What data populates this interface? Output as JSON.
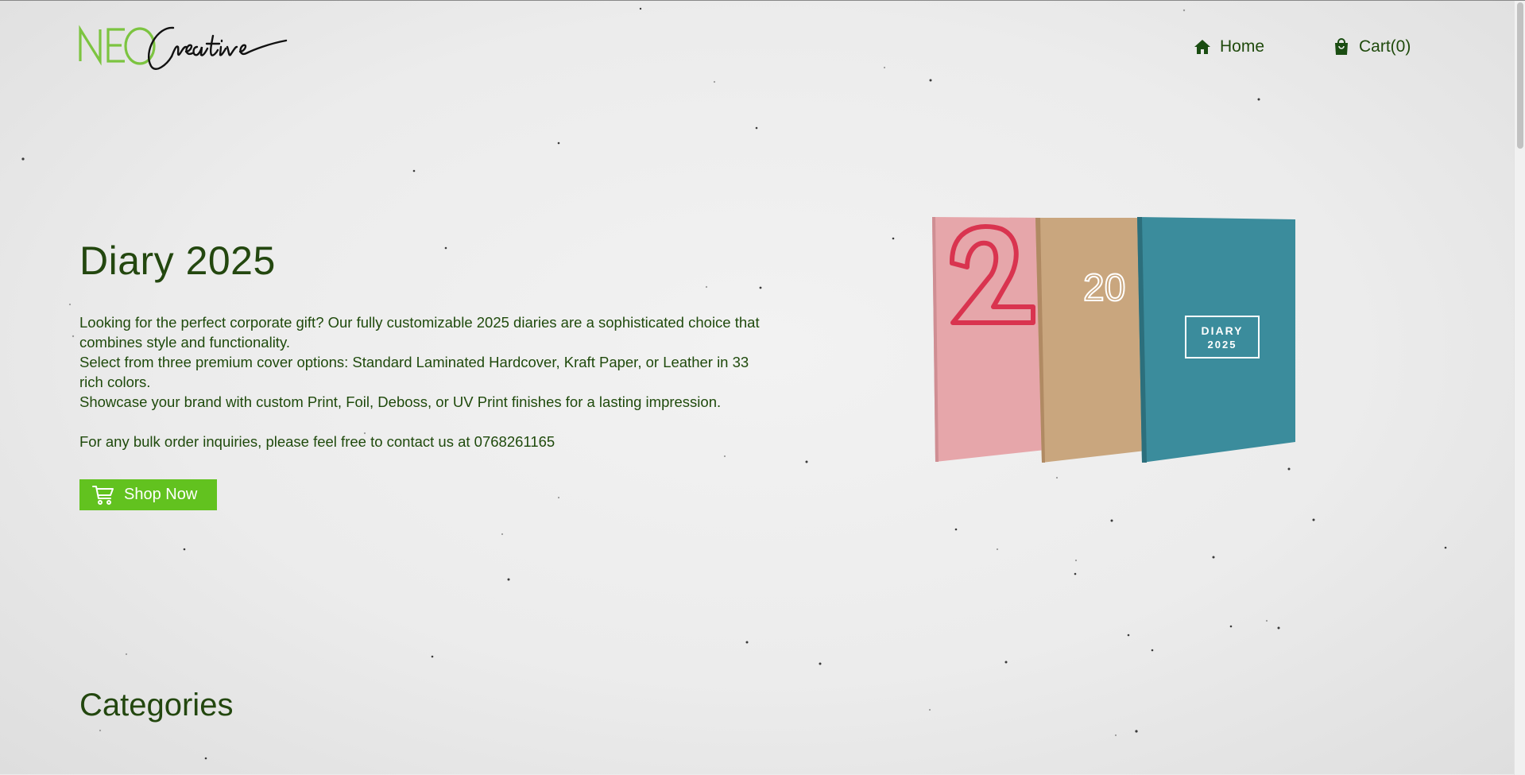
{
  "header": {
    "logo": {
      "primary": "NEO",
      "script": "Creative",
      "accent": "#7cc440"
    },
    "nav": [
      {
        "label": "Home",
        "icon": "home-icon"
      },
      {
        "label": "Cart(0)",
        "icon": "shopping-bag-icon"
      }
    ]
  },
  "hero": {
    "title": "Diary 2025",
    "paragraphs": [
      "Looking for the perfect corporate gift? Our fully customizable 2025 diaries are a sophisticated choice that combines style and functionality.",
      "Select from three premium cover options: Standard Laminated Hardcover, Kraft Paper, or Leather in 33 rich colors.",
      "Showcase your brand with custom Print, Foil, Deboss, or UV Print finishes for a lasting impression."
    ],
    "contact": "For any bulk order inquiries, please feel free to contact us at 0768261165",
    "shop_button": {
      "label": "Shop Now",
      "icon": "shopping-cart-icon",
      "color": "#62c21f"
    },
    "image": {
      "covers": [
        {
          "color": "#e6a6aa",
          "art": "2"
        },
        {
          "color": "#c9a67e",
          "art": "20"
        },
        {
          "color": "#3b8c9c",
          "art": "DIARY 2025",
          "line1": "DIARY",
          "line2": "2025"
        }
      ]
    }
  },
  "categories": {
    "title": "Categories"
  },
  "colors": {
    "text": "#1f4a0c",
    "brand_green": "#7cc440",
    "button_green": "#62c21f"
  }
}
